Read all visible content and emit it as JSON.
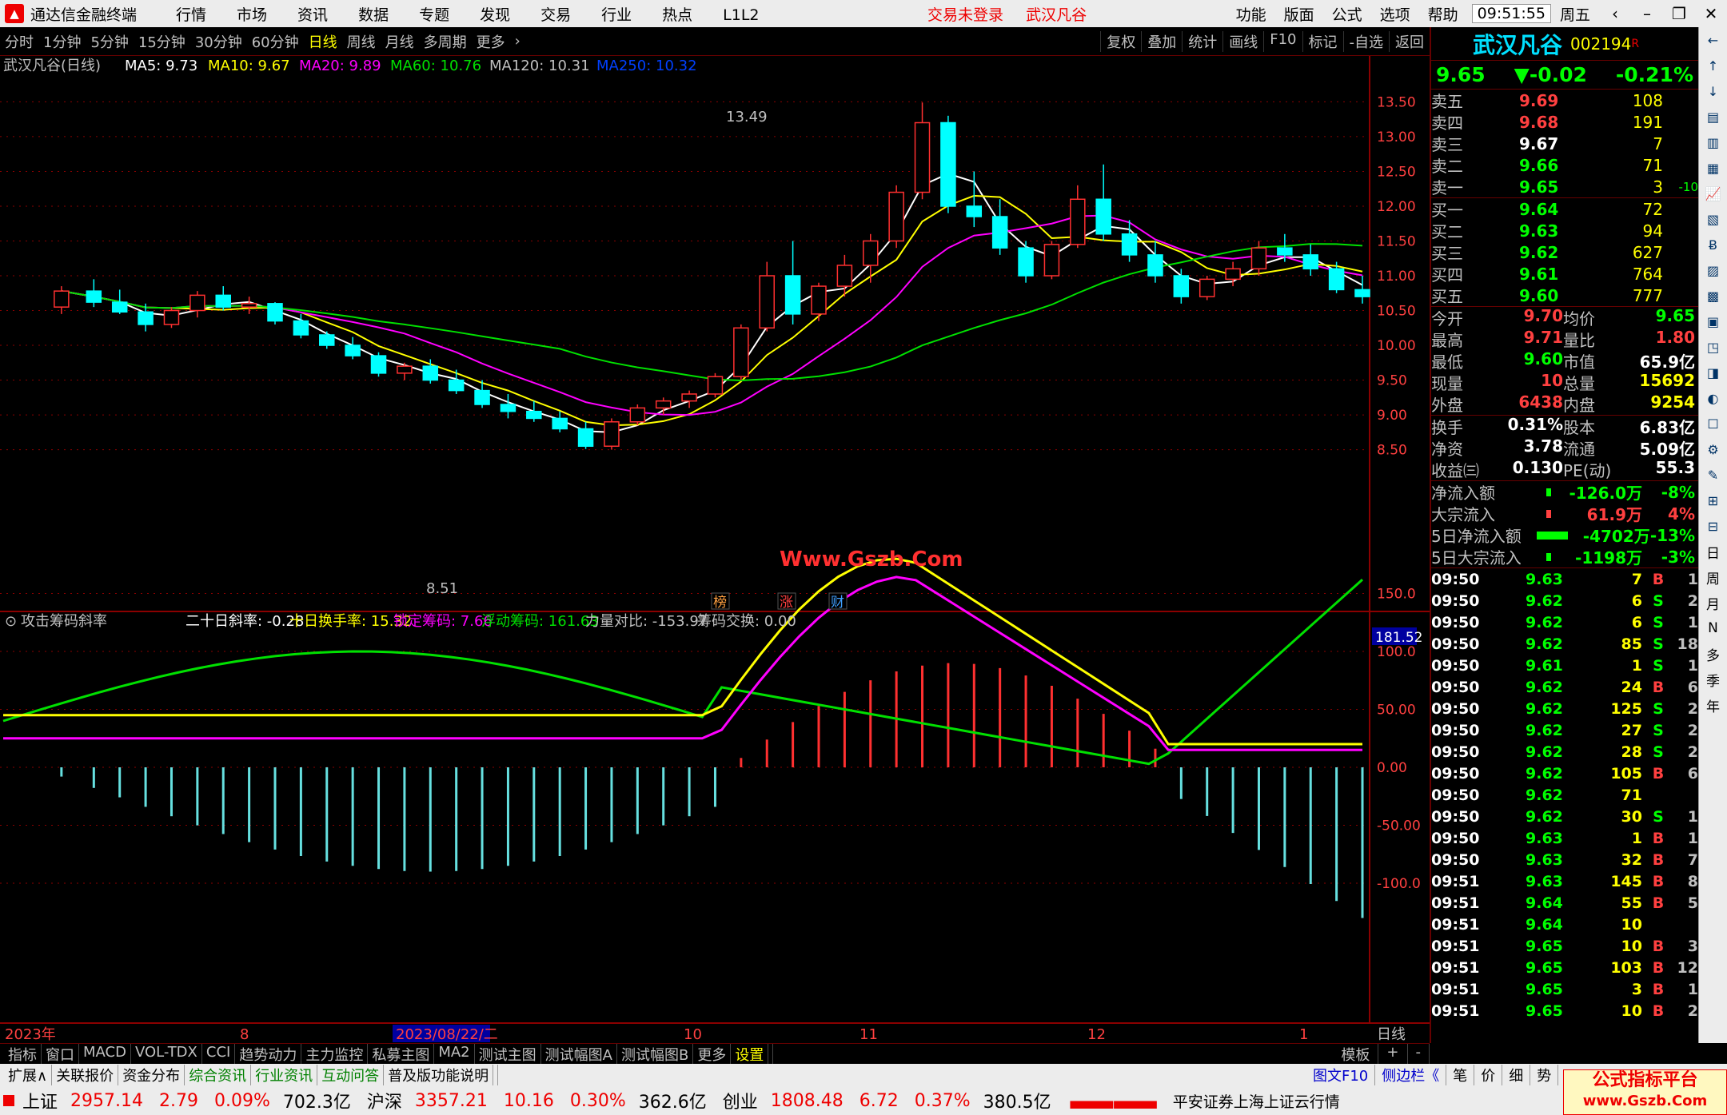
{
  "app": {
    "title": "通达信金融终端",
    "menu": [
      "行情",
      "市场",
      "资讯",
      "数据",
      "专题",
      "发现",
      "交易",
      "行业",
      "热点",
      "L1L2"
    ],
    "status": [
      "交易未登录",
      "武汉凡谷"
    ],
    "right_menu": [
      "功能",
      "版面",
      "公式",
      "选项",
      "帮助"
    ],
    "clock": "09:51:55",
    "weekday": "周五"
  },
  "toolbar": {
    "periods": [
      "分时",
      "1分钟",
      "5分钟",
      "15分钟",
      "30分钟",
      "60分钟",
      "日线",
      "周线",
      "月线",
      "多周期",
      "更多"
    ],
    "active": "日线",
    "buttons": [
      "复权",
      "叠加",
      "统计",
      "画线",
      "F10",
      "标记",
      "-自选",
      "返回"
    ]
  },
  "main_chart": {
    "legend_name": "武汉凡谷(日线)",
    "ma": [
      {
        "label": "MA5: 9.73",
        "color": "#ffffff"
      },
      {
        "label": "MA10: 9.67",
        "color": "#ffff00"
      },
      {
        "label": "MA20: 9.89",
        "color": "#ff00ff"
      },
      {
        "label": "MA60: 10.76",
        "color": "#00e000"
      },
      {
        "label": "MA120: 10.31",
        "color": "#c0c0c0"
      },
      {
        "label": "MA250: 10.32",
        "color": "#0040ff"
      }
    ],
    "y_ticks": [
      "13.50",
      "13.00",
      "12.50",
      "12.00",
      "11.50",
      "11.00",
      "10.50",
      "10.00",
      "9.50",
      "9.00",
      "8.50"
    ],
    "high_label": "13.49",
    "low_label": "8.51",
    "watermark": "Www.Gszb.Com",
    "event_marks": [
      "榜",
      "涨",
      "财"
    ]
  },
  "indicator": {
    "name": "攻击筹码斜率",
    "items": [
      {
        "label": "二十日斜率: -0.28",
        "color": "#ffffff"
      },
      {
        "label": "十日换手率: 15.32",
        "color": "#ffff00"
      },
      {
        "label": "锁定筹码: 7.66",
        "color": "#ff00ff"
      },
      {
        "label": "浮动筹码: 161.63",
        "color": "#00e000"
      },
      {
        "label": "力量对比: -153.97",
        "color": "#c0c0c0"
      },
      {
        "label": "筹码交换: 0.00",
        "color": "#c0c0c0"
      }
    ],
    "y_ticks": [
      "150.0",
      "100.0",
      "50.00",
      "0.00",
      "-50.00",
      "-100.0"
    ],
    "y_box": "181.52"
  },
  "x_axis": {
    "labels": [
      "2023年",
      "8",
      "2023/08/22/二",
      "10",
      "11",
      "12",
      "1"
    ],
    "period": "日线"
  },
  "chart_data": {
    "type": "candlestick",
    "title": "",
    "xlabel": "",
    "ylabel": "",
    "ylim": [
      8.3,
      13.7
    ],
    "xlim": [
      0,
      210
    ],
    "high": {
      "date_index": 120,
      "value": 13.49
    },
    "low": {
      "date_index": 70,
      "value": 8.51
    },
    "candles": [
      [
        9,
        10.55,
        10.85,
        10.45,
        10.78
      ],
      [
        14,
        10.78,
        10.95,
        10.55,
        10.62
      ],
      [
        18,
        10.62,
        10.8,
        10.45,
        10.48
      ],
      [
        22,
        10.48,
        10.6,
        10.2,
        10.3
      ],
      [
        26,
        10.3,
        10.55,
        10.25,
        10.5
      ],
      [
        30,
        10.5,
        10.78,
        10.4,
        10.72
      ],
      [
        34,
        10.72,
        10.85,
        10.5,
        10.55
      ],
      [
        38,
        10.55,
        10.7,
        10.45,
        10.6
      ],
      [
        42,
        10.6,
        10.62,
        10.3,
        10.35
      ],
      [
        46,
        10.35,
        10.45,
        10.1,
        10.15
      ],
      [
        50,
        10.15,
        10.2,
        9.95,
        10.0
      ],
      [
        54,
        10.0,
        10.12,
        9.8,
        9.85
      ],
      [
        58,
        9.85,
        9.9,
        9.55,
        9.6
      ],
      [
        62,
        9.6,
        9.75,
        9.5,
        9.7
      ],
      [
        66,
        9.7,
        9.8,
        9.45,
        9.5
      ],
      [
        70,
        9.5,
        9.65,
        9.3,
        9.35
      ],
      [
        74,
        9.35,
        9.5,
        9.1,
        9.15
      ],
      [
        78,
        9.15,
        9.3,
        8.95,
        9.05
      ],
      [
        82,
        9.05,
        9.2,
        8.9,
        8.95
      ],
      [
        86,
        8.95,
        9.05,
        8.75,
        8.8
      ],
      [
        90,
        8.8,
        8.9,
        8.51,
        8.55
      ],
      [
        94,
        8.55,
        8.95,
        8.5,
        8.9
      ],
      [
        98,
        8.9,
        9.15,
        8.85,
        9.1
      ],
      [
        102,
        9.1,
        9.25,
        9.0,
        9.2
      ],
      [
        106,
        9.2,
        9.35,
        9.1,
        9.3
      ],
      [
        110,
        9.3,
        9.6,
        9.25,
        9.55
      ],
      [
        114,
        9.55,
        10.3,
        9.5,
        10.25
      ],
      [
        118,
        10.25,
        11.2,
        10.2,
        11.0
      ],
      [
        122,
        11.0,
        11.5,
        10.3,
        10.45
      ],
      [
        126,
        10.45,
        10.9,
        10.35,
        10.85
      ],
      [
        130,
        10.85,
        11.3,
        10.7,
        11.15
      ],
      [
        134,
        11.15,
        11.6,
        10.9,
        11.5
      ],
      [
        138,
        11.5,
        12.3,
        11.4,
        12.2
      ],
      [
        142,
        12.2,
        13.49,
        12.1,
        13.2
      ],
      [
        146,
        13.2,
        13.3,
        11.9,
        12.0
      ],
      [
        150,
        12.0,
        12.5,
        11.7,
        11.85
      ],
      [
        154,
        11.85,
        12.1,
        11.3,
        11.4
      ],
      [
        158,
        11.4,
        11.5,
        10.9,
        11.0
      ],
      [
        162,
        11.0,
        11.5,
        10.95,
        11.45
      ],
      [
        166,
        11.45,
        12.3,
        11.4,
        12.1
      ],
      [
        170,
        12.1,
        12.6,
        11.5,
        11.6
      ],
      [
        174,
        11.6,
        11.8,
        11.2,
        11.3
      ],
      [
        178,
        11.3,
        11.5,
        10.9,
        11.0
      ],
      [
        182,
        11.0,
        11.1,
        10.6,
        10.7
      ],
      [
        186,
        10.7,
        11.0,
        10.65,
        10.95
      ],
      [
        190,
        10.95,
        11.2,
        10.85,
        11.1
      ],
      [
        194,
        11.1,
        11.5,
        11.0,
        11.4
      ],
      [
        198,
        11.4,
        11.6,
        11.2,
        11.3
      ],
      [
        202,
        11.3,
        11.45,
        11.0,
        11.1
      ],
      [
        206,
        11.1,
        11.2,
        10.75,
        10.8
      ],
      [
        210,
        10.8,
        11.0,
        10.6,
        10.7
      ]
    ]
  },
  "quote": {
    "name": "武汉凡谷",
    "code": "002194",
    "badge": "R",
    "price": "9.65",
    "change": "▼-0.02",
    "pct": "-0.21%",
    "asks": [
      {
        "l": "卖五",
        "p": "9.69",
        "v": "108",
        "c": "red"
      },
      {
        "l": "卖四",
        "p": "9.68",
        "v": "191",
        "c": "red"
      },
      {
        "l": "卖三",
        "p": "9.67",
        "v": "7",
        "c": "white"
      },
      {
        "l": "卖二",
        "p": "9.66",
        "v": "71",
        "c": "green"
      },
      {
        "l": "卖一",
        "p": "9.65",
        "v": "3",
        "c": "green",
        "x": "-10"
      }
    ],
    "bids": [
      {
        "l": "买一",
        "p": "9.64",
        "v": "72",
        "c": "green"
      },
      {
        "l": "买二",
        "p": "9.63",
        "v": "94",
        "c": "green"
      },
      {
        "l": "买三",
        "p": "9.62",
        "v": "627",
        "c": "green"
      },
      {
        "l": "买四",
        "p": "9.61",
        "v": "764",
        "c": "green"
      },
      {
        "l": "买五",
        "p": "9.60",
        "v": "777",
        "c": "green"
      }
    ],
    "stats": [
      [
        [
          "今开",
          "9.70",
          "#ff4040"
        ],
        [
          "均价",
          "9.65",
          "#00ff00"
        ]
      ],
      [
        [
          "最高",
          "9.71",
          "#ff4040"
        ],
        [
          "量比",
          "1.80",
          "#ff4040"
        ]
      ],
      [
        [
          "最低",
          "9.60",
          "#00ff00"
        ],
        [
          "市值",
          "65.9亿",
          "#ffffff"
        ]
      ],
      [
        [
          "现量",
          "10",
          "#ff4040"
        ],
        [
          "总量",
          "15692",
          "#ffff00"
        ]
      ],
      [
        [
          "外盘",
          "6438",
          "#ff4040"
        ],
        [
          "内盘",
          "9254",
          "#ffff00"
        ]
      ]
    ],
    "stats2": [
      [
        [
          "换手",
          "0.31%",
          "#ffffff"
        ],
        [
          "股本",
          "6.83亿",
          "#ffffff"
        ]
      ],
      [
        [
          "净资",
          "3.78",
          "#ffffff"
        ],
        [
          "流通",
          "5.09亿",
          "#ffffff"
        ]
      ],
      [
        [
          "收益㈢",
          "0.130",
          "#ffffff"
        ],
        [
          "PE(动)",
          "55.3",
          "#ffffff"
        ]
      ]
    ],
    "flow": [
      [
        "净流入额",
        "-126.0万",
        "-8%",
        "#00ff00"
      ],
      [
        "大宗流入",
        "61.9万",
        "4%",
        "#ff4040"
      ],
      [
        "5日净流入额",
        "-4702万",
        "-13%",
        "#00ff00"
      ],
      [
        "5日大宗流入",
        "-1198万",
        "-3%",
        "#00ff00"
      ]
    ],
    "trades": [
      [
        "09:50",
        "9.63",
        "7",
        "B",
        "1"
      ],
      [
        "09:50",
        "9.62",
        "6",
        "S",
        "2"
      ],
      [
        "09:50",
        "9.62",
        "6",
        "S",
        "1"
      ],
      [
        "09:50",
        "9.62",
        "85",
        "S",
        "18"
      ],
      [
        "09:50",
        "9.61",
        "1",
        "S",
        "1"
      ],
      [
        "09:50",
        "9.62",
        "24",
        "B",
        "6"
      ],
      [
        "09:50",
        "9.62",
        "125",
        "S",
        "2"
      ],
      [
        "09:50",
        "9.62",
        "27",
        "S",
        "2"
      ],
      [
        "09:50",
        "9.62",
        "28",
        "S",
        "2"
      ],
      [
        "09:50",
        "9.62",
        "105",
        "B",
        "6"
      ],
      [
        "09:50",
        "9.62",
        "71",
        "",
        ""
      ],
      [
        "09:50",
        "9.62",
        "30",
        "S",
        "1"
      ],
      [
        "09:50",
        "9.63",
        "1",
        "B",
        "1"
      ],
      [
        "09:50",
        "9.63",
        "32",
        "B",
        "7"
      ],
      [
        "09:51",
        "9.63",
        "145",
        "B",
        "8"
      ],
      [
        "09:51",
        "9.64",
        "55",
        "B",
        "5"
      ],
      [
        "09:51",
        "9.64",
        "10",
        "",
        ""
      ],
      [
        "09:51",
        "9.65",
        "10",
        "B",
        "3"
      ],
      [
        "09:51",
        "9.65",
        "103",
        "B",
        "12"
      ],
      [
        "09:51",
        "9.65",
        "3",
        "B",
        "1"
      ],
      [
        "09:51",
        "9.65",
        "10",
        "B",
        "2"
      ]
    ]
  },
  "sidetools": [
    "日",
    "周",
    "月",
    "N",
    "多",
    "季",
    "年"
  ],
  "tabs1": {
    "items": [
      "指标",
      "窗口",
      "MACD",
      "VOL-TDX",
      "CCI",
      "趋势动力",
      "主力监控",
      "私募主图",
      "MA2",
      "测试主图",
      "测试幅图A",
      "测试幅图B",
      "更多",
      "设置"
    ],
    "right": [
      "模板",
      "+",
      "-"
    ]
  },
  "tabs2": {
    "items": [
      "扩展∧",
      "关联报价",
      "资金分布",
      "综合资讯",
      "行业资讯",
      "互动问答",
      "普及版功能说明"
    ],
    "right": [
      "图文F10",
      "侧边栏《",
      "笔",
      "价",
      "细",
      "势"
    ]
  },
  "statusbar": {
    "indices": [
      {
        "name": "上证",
        "v": "2957.14",
        "c": "2.79",
        "p": "0.09%",
        "a": "702.3亿"
      },
      {
        "name": "沪深",
        "v": "3357.21",
        "c": "10.16",
        "p": "0.30%",
        "a": "362.6亿"
      },
      {
        "name": "创业",
        "v": "1808.48",
        "c": "6.72",
        "p": "0.37%",
        "a": "380.5亿"
      }
    ],
    "msg": "平安证券上海上证云行情"
  },
  "brand": {
    "line1": "公式指标平台",
    "line2": "www.Gszb.Com"
  }
}
